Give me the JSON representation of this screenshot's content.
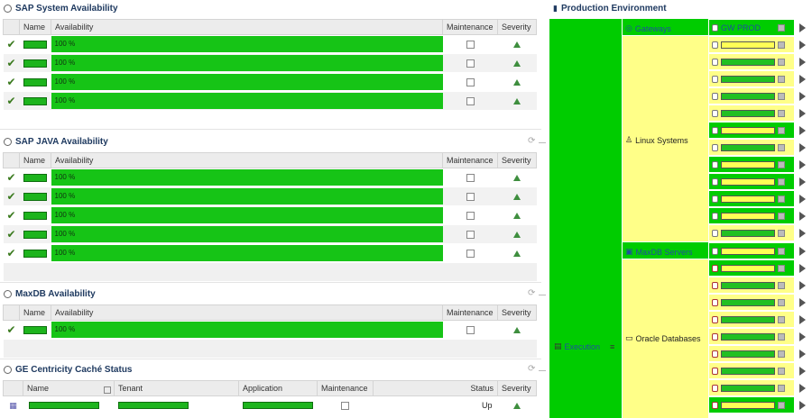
{
  "sap_system": {
    "title": "SAP System Availability",
    "headers": [
      "Name",
      "Availability",
      "Maintenance",
      "Severity"
    ],
    "rows": [
      "100 %",
      "100 %",
      "100 %",
      "100 %"
    ]
  },
  "sap_java": {
    "title": "SAP JAVA Availability",
    "headers": [
      "Name",
      "Availability",
      "Maintenance",
      "Severity"
    ],
    "rows": [
      "100 %",
      "100 %",
      "100 %",
      "100 %",
      "100 %"
    ]
  },
  "maxdb": {
    "title": "MaxDB Availability",
    "headers": [
      "Name",
      "Availability",
      "Maintenance",
      "Severity"
    ],
    "rows": [
      "100 %"
    ]
  },
  "ge_centricity": {
    "title": "GE Centricity Caché Status",
    "headers": [
      "Name",
      "Tenant",
      "Application",
      "Maintenance",
      "Status",
      "Severity"
    ],
    "row_status": "Up"
  },
  "production": {
    "title": "Production Environment",
    "root_label": "Execution",
    "gateways_label": "Gateways",
    "gw_prod_label": "GW PROD",
    "linux_label": "Linux Systems",
    "maxdb_servers_label": "MaxDB Servers",
    "oracle_label": "Oracle Databases"
  },
  "colors": {
    "ok_green": "#16c416",
    "warn_yellow": "#ffff88",
    "title_blue": "#1f3a60"
  }
}
